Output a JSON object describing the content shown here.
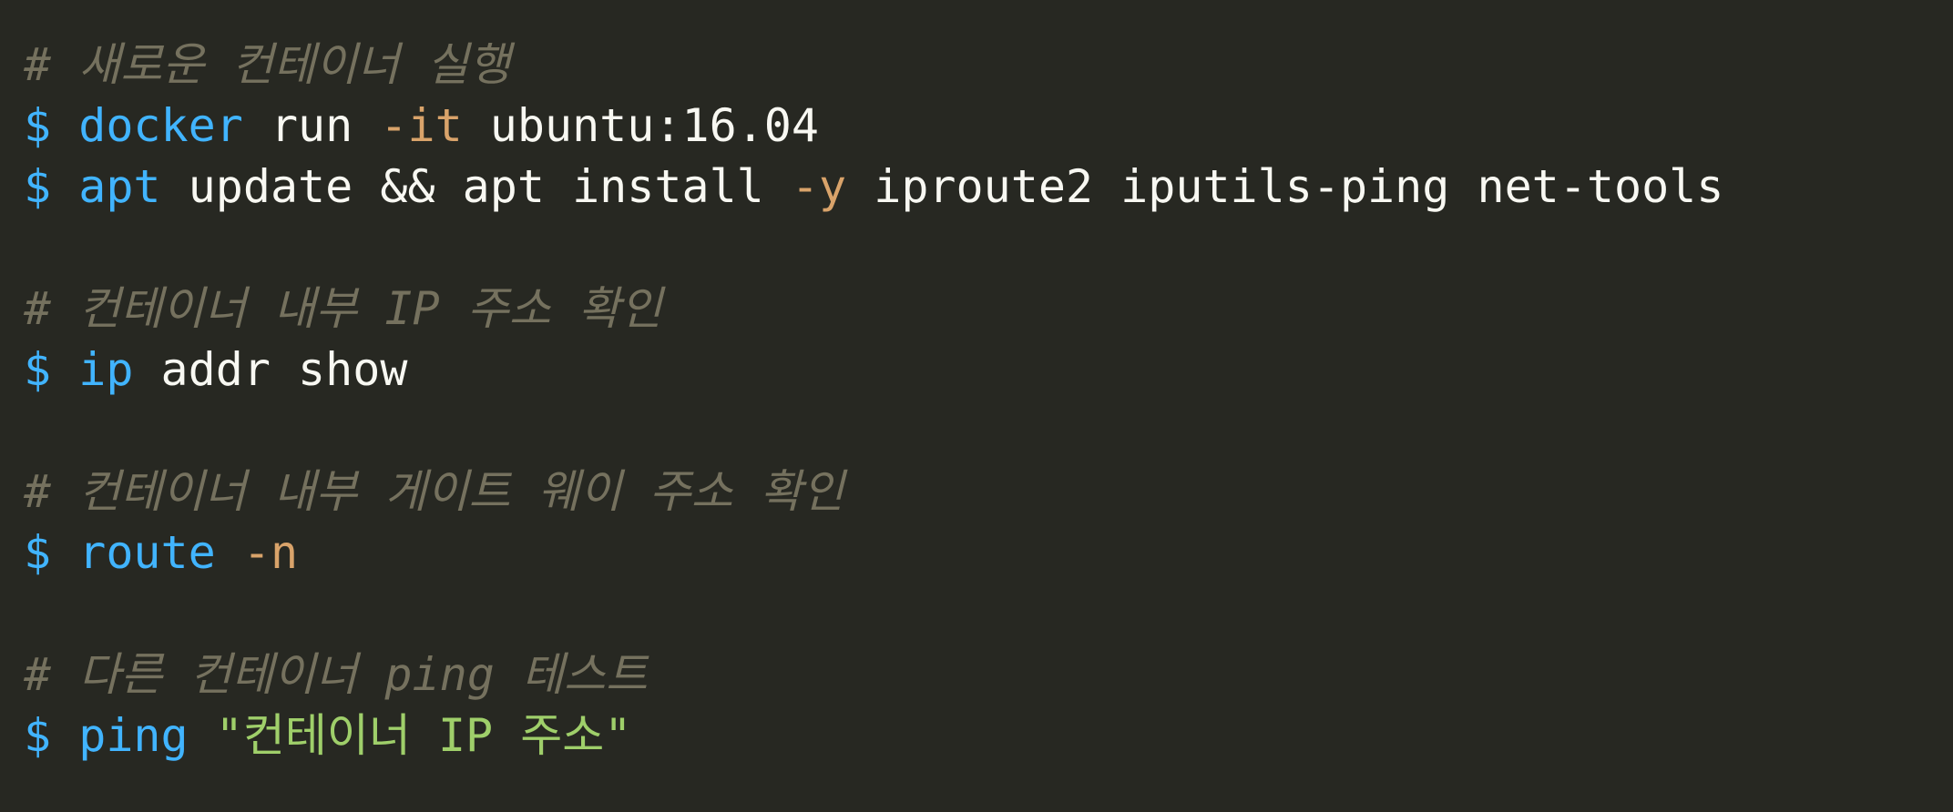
{
  "code": {
    "prompt_symbol": "$",
    "comment_1": "# 새로운 컨테이너 실행",
    "line_1": {
      "cmd": "docker",
      "args_before": " run ",
      "flag": "-it",
      "args_after": " ubuntu:16.04"
    },
    "line_2": {
      "cmd": "apt",
      "args_before": " update && apt install ",
      "flag": "-y",
      "args_after": " iproute2 iputils-ping net-tools"
    },
    "comment_2": "# 컨테이너 내부 IP 주소 확인",
    "line_3": {
      "cmd": "ip",
      "args_after": " addr show"
    },
    "comment_3": "# 컨테이너 내부 게이트 웨이 주소 확인",
    "line_4": {
      "cmd": "route",
      "space": " ",
      "flag": "-n"
    },
    "comment_4": "# 다른 컨테이너 ping 테스트",
    "line_5": {
      "cmd": "ping",
      "space": " ",
      "string": "\"컨테이너 IP 주소\""
    }
  },
  "colors": {
    "background": "#272822",
    "comment": "#75715e",
    "command": "#41b4ff",
    "flag": "#d9a36a",
    "text": "#f8f8f2",
    "string": "#9fcf6a"
  }
}
